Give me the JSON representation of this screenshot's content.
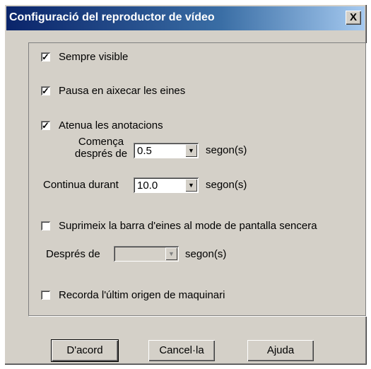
{
  "window": {
    "title": "Configuració del reproductor de vídeo",
    "close_label": "X"
  },
  "options": {
    "always_visible": {
      "label": "Sempre visible",
      "checked": true
    },
    "pause_on_tools": {
      "label": "Pausa en aixecar les eines",
      "checked": true
    },
    "fade_annotations": {
      "label": "Atenua les anotacions",
      "checked": true
    },
    "starts_after_label": "Comença després de",
    "starts_after_value": "0.5",
    "continues_for_label": "Continua durant",
    "continues_for_value": "10.0",
    "seconds_unit": "segon(s)",
    "suppress_toolbar": {
      "label": "Suprimeix la barra d'eines al mode de pantalla sencera",
      "checked": false
    },
    "after_label": "Després de",
    "after_value": "",
    "remember_hw": {
      "label": "Recorda l'últim origen de maquinari",
      "checked": false
    }
  },
  "buttons": {
    "ok": "D'acord",
    "cancel": "Cancel·la",
    "help": "Ajuda"
  }
}
